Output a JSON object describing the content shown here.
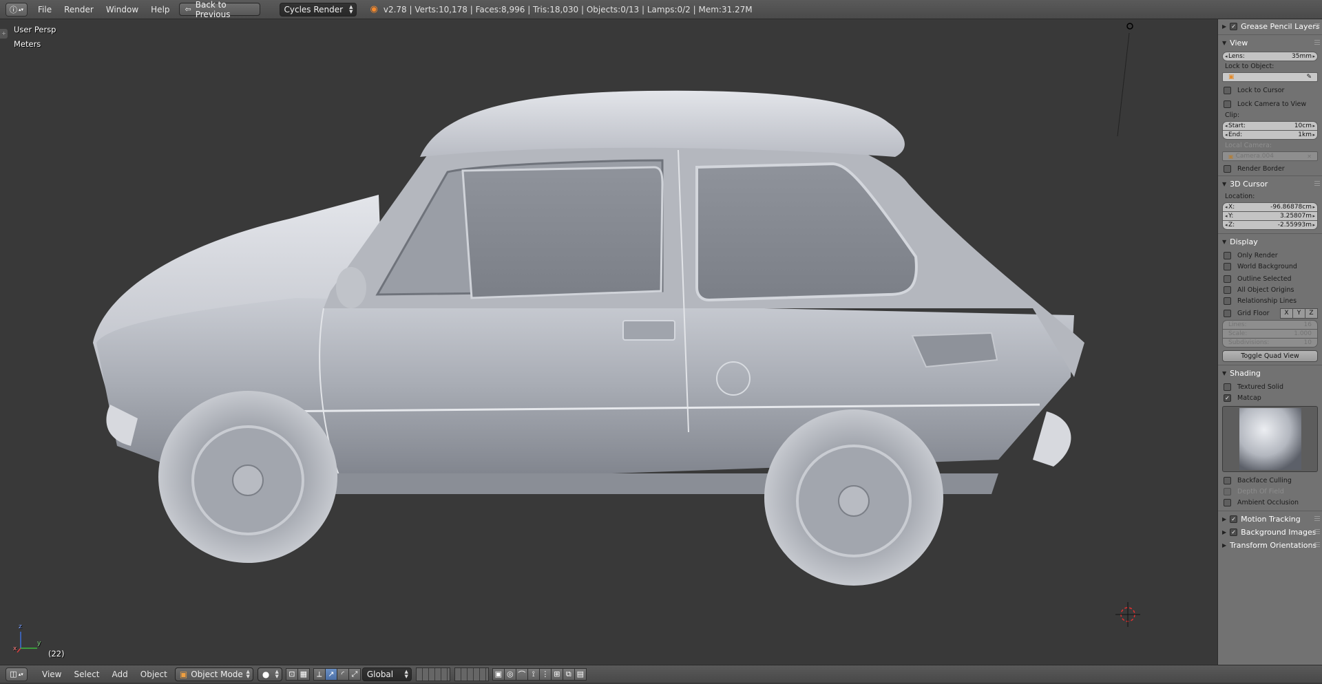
{
  "header": {
    "info_editor_icon": "info-icon",
    "menu": [
      "File",
      "Render",
      "Window",
      "Help"
    ],
    "back_button": "Back to Previous",
    "render_engine": "Cycles Render",
    "stats": "v2.78 | Verts:10,178 | Faces:8,996 | Tris:18,030 | Objects:0/13 | Lamps:0/2 | Mem:31.27M"
  },
  "viewport": {
    "view_name": "User Persp",
    "units": "Meters",
    "frame": "(22)",
    "axis_x": "x",
    "axis_y": "y",
    "axis_z": "z"
  },
  "panel": {
    "grease_pencil": "Grease Pencil Layers",
    "view": {
      "title": "View",
      "lens_label": "Lens:",
      "lens_value": "35mm",
      "lock_to_object": "Lock to Object:",
      "lock_to_cursor": "Lock to Cursor",
      "lock_camera": "Lock Camera to View",
      "clip": "Clip:",
      "start_label": "Start:",
      "start_value": "10cm",
      "end_label": "End:",
      "end_value": "1km",
      "local_camera": "Local Camera:",
      "camera_name": "Camera.004",
      "render_border": "Render Border"
    },
    "cursor": {
      "title": "3D Cursor",
      "location": "Location:",
      "x_label": "X:",
      "x_value": "-96.86878cm",
      "y_label": "Y:",
      "y_value": "3.25807m",
      "z_label": "Z:",
      "z_value": "-2.55993m"
    },
    "display": {
      "title": "Display",
      "only_render": "Only Render",
      "world_background": "World Background",
      "outline_selected": "Outline Selected",
      "all_object_origins": "All Object Origins",
      "relationship_lines": "Relationship Lines",
      "grid_floor": "Grid Floor",
      "axis_buttons": [
        "X",
        "Y",
        "Z"
      ],
      "lines_label": "Lines:",
      "lines_value": "16",
      "scale_label": "Scale:",
      "scale_value": "1.000",
      "subdiv_label": "Subdivisions:",
      "subdiv_value": "10",
      "toggle_quad": "Toggle Quad View"
    },
    "shading": {
      "title": "Shading",
      "textured_solid": "Textured Solid",
      "matcap": "Matcap",
      "backface_culling": "Backface Culling",
      "depth_of_field": "Depth Of Field",
      "ambient_occlusion": "Ambient Occlusion"
    },
    "motion_tracking": "Motion Tracking",
    "background_images": "Background Images",
    "transform_orientations": "Transform Orientations"
  },
  "footer": {
    "menu": [
      "View",
      "Select",
      "Add",
      "Object"
    ],
    "mode": "Object Mode",
    "orientation": "Global"
  },
  "colors": {
    "viewport_bg": "#393939",
    "panel_bg": "#727272",
    "header_bg": "#4f4f4f",
    "active_blue": "#5680c2"
  }
}
